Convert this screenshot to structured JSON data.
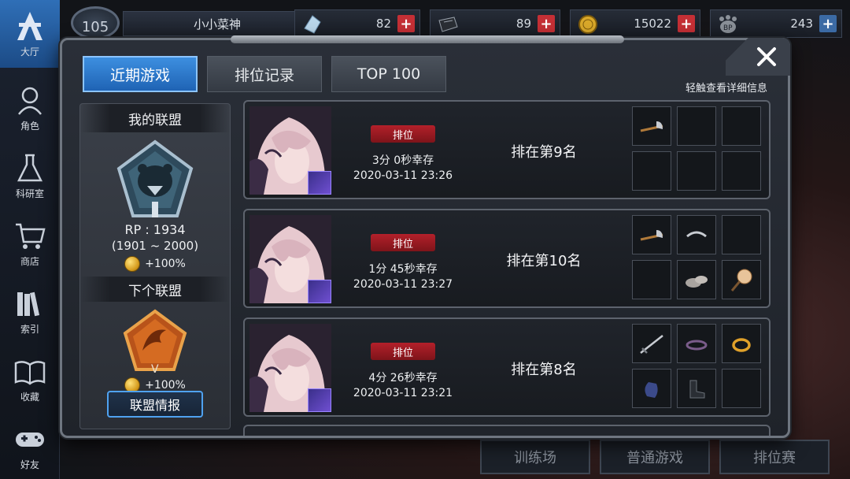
{
  "sidebar": {
    "items": [
      {
        "label": "大厅",
        "icon": "lobby-icon"
      },
      {
        "label": "角色",
        "icon": "character-icon"
      },
      {
        "label": "科研室",
        "icon": "flask-icon"
      },
      {
        "label": "商店",
        "icon": "cart-icon"
      },
      {
        "label": "索引",
        "icon": "books-icon"
      },
      {
        "label": "收藏",
        "icon": "open-book-icon"
      },
      {
        "label": "好友",
        "icon": "gamepad-icon"
      }
    ]
  },
  "header": {
    "level": "105",
    "player_name": "小小菜神",
    "currencies": [
      {
        "icon": "crystal-icon",
        "value": "82",
        "add": "+"
      },
      {
        "icon": "ticket-icon",
        "value": "89",
        "add": "+"
      },
      {
        "icon": "gold-coin-icon",
        "value": "15022",
        "add": "+"
      },
      {
        "icon": "bp-paw-icon",
        "value": "243",
        "add": "+"
      }
    ]
  },
  "tabs": [
    {
      "label": "近期游戏",
      "active": true
    },
    {
      "label": "排位记录",
      "active": false
    },
    {
      "label": "TOP 100",
      "active": false
    }
  ],
  "hint": "轻触查看详细信息",
  "league": {
    "my_league_title": "我的联盟",
    "rp_text": "RP : 1934",
    "rp_range": "(1901 ~ 2000)",
    "bonus": "+100%",
    "current_tier": "I",
    "next_league_title": "下个联盟",
    "next_tier": "V",
    "next_bonus": "+100%",
    "info_button": "联盟情报"
  },
  "matches": [
    {
      "mode": "排位",
      "survival": "3分 0秒幸存",
      "datetime": "2020-03-11 23:26",
      "placement": "排在第9名",
      "items": [
        "axe-icon",
        "",
        "",
        "",
        "",
        ""
      ]
    },
    {
      "mode": "排位",
      "survival": "1分 45秒幸存",
      "datetime": "2020-03-11 23:27",
      "placement": "排在第10名",
      "items": [
        "axe-icon",
        "ring-icon",
        "",
        "",
        "rock-icon",
        "lollipop-icon"
      ]
    },
    {
      "mode": "排位",
      "survival": "4分 26秒幸存",
      "datetime": "2020-03-11 23:21",
      "placement": "排在第8名",
      "items": [
        "sword-icon",
        "bracelet-icon",
        "gold-ring-icon",
        "glove-icon",
        "boots-icon",
        ""
      ]
    }
  ],
  "bottom": {
    "training": "训练场",
    "normal": "普通游戏",
    "ranked": "排位赛"
  },
  "colors": {
    "tab_active": "#1f63b4",
    "rank_pill": "#b3202a",
    "plus_red": "#c42f35"
  }
}
